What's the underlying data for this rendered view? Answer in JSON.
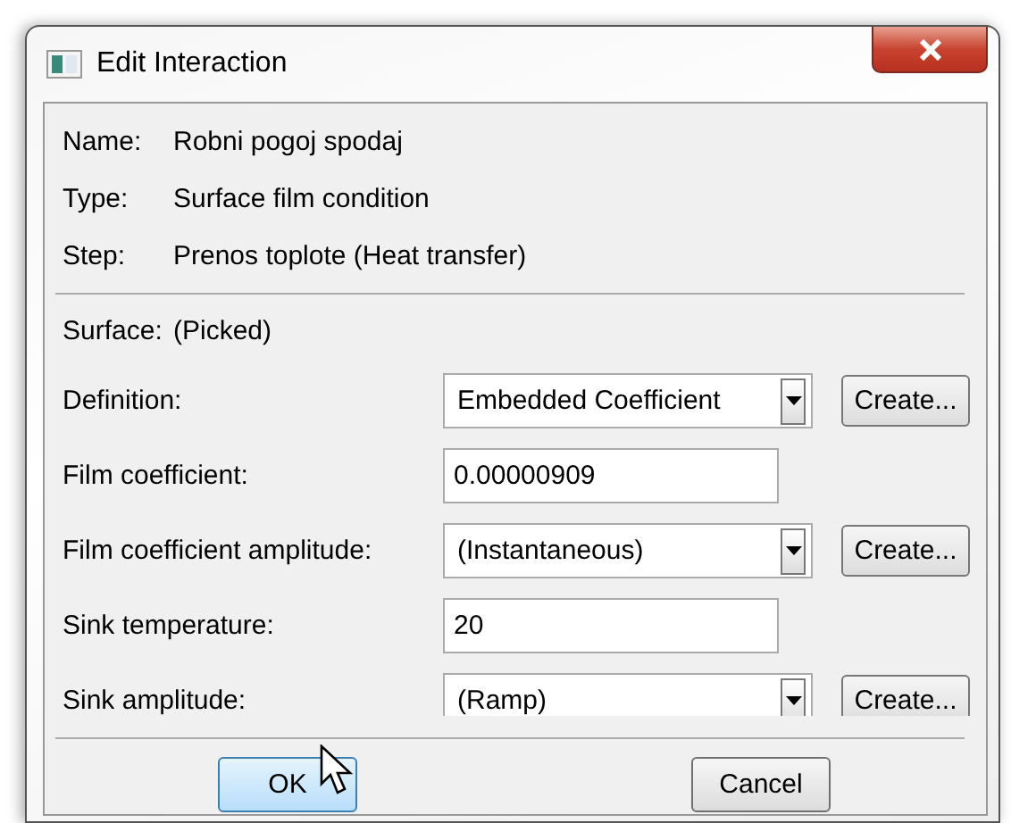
{
  "window": {
    "title": "Edit Interaction"
  },
  "info": [
    {
      "label": "Name:",
      "value": "Robni pogoj spodaj"
    },
    {
      "label": "Type:",
      "value": "Surface film condition"
    },
    {
      "label": "Step:",
      "value": "Prenos toplote (Heat transfer)"
    }
  ],
  "surface": {
    "label": "Surface:",
    "value": "(Picked)"
  },
  "fields": [
    {
      "kind": "combo",
      "label": "Definition:",
      "value": "Embedded Coefficient",
      "button": "Create..."
    },
    {
      "kind": "text",
      "label": "Film coefficient:",
      "value": "0.00000909"
    },
    {
      "kind": "combo",
      "label": "Film coefficient amplitude:",
      "value": "(Instantaneous)",
      "button": "Create..."
    },
    {
      "kind": "text",
      "label": "Sink temperature:",
      "value": "20"
    },
    {
      "kind": "combo",
      "label": "Sink amplitude:",
      "value": "(Ramp)",
      "button": "Create..."
    }
  ],
  "buttons": [
    {
      "label": "OK",
      "selected": true
    },
    {
      "label": "Cancel",
      "selected": false
    }
  ]
}
